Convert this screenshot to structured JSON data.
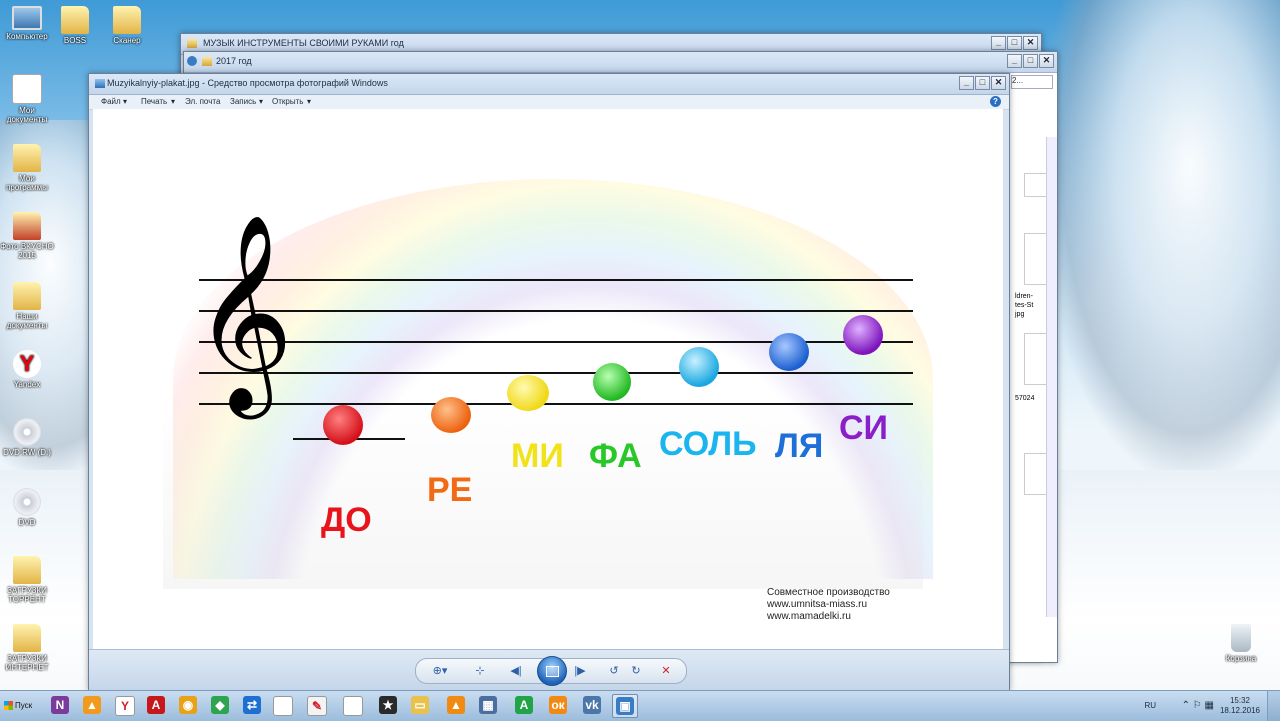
{
  "desktop": {
    "icons": [
      {
        "label": "Компьютер",
        "icon": "computer-icon"
      },
      {
        "label": "BOSS",
        "icon": "folder-icon"
      },
      {
        "label": "Сканер",
        "icon": "folder-icon"
      },
      {
        "label": "Мои документы",
        "icon": "documents-icon"
      },
      {
        "label": "Мои программы",
        "icon": "folder-icon"
      },
      {
        "label": "Фото ВКУСНО 2015",
        "icon": "photo-icon"
      },
      {
        "label": "Наши документы",
        "icon": "folder-icon"
      },
      {
        "label": "Yandex",
        "icon": "yandex-icon"
      },
      {
        "label": "DVD RW (D:)",
        "icon": "disc-drive-icon"
      },
      {
        "label": "DVD",
        "icon": "dvd-icon"
      },
      {
        "label": "ЗАГРУЗКИ ТОРРЕНТ",
        "icon": "folder-icon"
      },
      {
        "label": "ЗАГРУЗКИ ИНТЕРНЕТ",
        "icon": "folder-icon"
      },
      {
        "label": "Корзина",
        "icon": "recycle-bin-icon"
      }
    ]
  },
  "windows": {
    "explorer_back": {
      "title": "МУЗЫК ИНСТРУМЕНТЫ СВОИМИ РУКАМИ год"
    },
    "explorer_mid": {
      "title": "2017 год",
      "side_labels": [
        "ldren-",
        "tes-St",
        "jpg",
        "57024"
      ]
    },
    "viewer": {
      "title": "Muzyikalnyiy-plakat.jpg - Средство просмотра фотографий Windows",
      "menu": [
        "Файл",
        "Печать",
        "Эл. почта",
        "Запись",
        "Открыть"
      ],
      "poster": {
        "notes": [
          {
            "label": "ДО",
            "color": "#e8141c"
          },
          {
            "label": "РЕ",
            "color": "#f26a14"
          },
          {
            "label": "МИ",
            "color": "#f2e21a"
          },
          {
            "label": "ФА",
            "color": "#28c828"
          },
          {
            "label": "СОЛЬ",
            "color": "#1ab4ee"
          },
          {
            "label": "ЛЯ",
            "color": "#1e6fd8"
          },
          {
            "label": "СИ",
            "color": "#8a1ec8"
          }
        ],
        "credits": [
          "Совместное производство",
          "www.umnitsa-miass.ru",
          "www.mamadelki.ru"
        ]
      },
      "controls": [
        "zoom-icon",
        "fit-icon",
        "previous-icon",
        "slideshow-icon",
        "next-icon",
        "rotate-left-icon",
        "rotate-right-icon",
        "delete-icon"
      ]
    }
  },
  "taskbar": {
    "start_label": "Пуск",
    "apps": [
      {
        "name": "onenote-icon",
        "color": "#7a3b9a",
        "glyph": "N"
      },
      {
        "name": "avast-icon",
        "color": "#f29a1e",
        "glyph": "▲"
      },
      {
        "name": "yandex-browser-icon",
        "color": "#ffffff",
        "glyph": "Y"
      },
      {
        "name": "acrobat-icon",
        "color": "#c8161d",
        "glyph": "A"
      },
      {
        "name": "media-player-icon",
        "color": "#e8a21a",
        "glyph": "◉"
      },
      {
        "name": "chrome-icon",
        "color": "#2ea44f",
        "glyph": "◆"
      },
      {
        "name": "teamviewer-icon",
        "color": "#1d6fd1",
        "glyph": "⇄"
      },
      {
        "name": "document-icon",
        "color": "#ffffff",
        "glyph": ""
      },
      {
        "name": "paint-icon",
        "color": "#f3f3f3",
        "glyph": "✎"
      },
      {
        "name": "document-icon",
        "color": "#ffffff",
        "glyph": ""
      },
      {
        "name": "screenshot-icon",
        "color": "#2a2a2a",
        "glyph": "★"
      },
      {
        "name": "explorer-icon",
        "color": "#e8c24a",
        "glyph": "▭"
      },
      {
        "name": "vlc-icon",
        "color": "#f08a12",
        "glyph": "▲"
      },
      {
        "name": "calculator-icon",
        "color": "#4a6ea0",
        "glyph": "▦"
      },
      {
        "name": "app-a-icon",
        "color": "#21a447",
        "glyph": "A"
      },
      {
        "name": "odnoklassniki-icon",
        "color": "#f28a12",
        "glyph": "ок"
      },
      {
        "name": "vk-icon",
        "color": "#4a76a8",
        "glyph": "vk"
      },
      {
        "name": "photo-viewer-icon",
        "color": "#3a7cc4",
        "glyph": "▣"
      }
    ],
    "language": "RU",
    "time": "15:32",
    "date": "18.12.2016"
  }
}
